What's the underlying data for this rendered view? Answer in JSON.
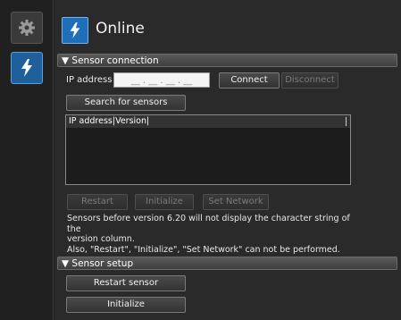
{
  "sidebar": {
    "items": [
      {
        "icon": "gear-icon",
        "label": "Settings"
      },
      {
        "icon": "lightning-icon",
        "label": "Online"
      }
    ],
    "accent": "#1f6fb8"
  },
  "header": {
    "title": "Online",
    "icon": "lightning-icon"
  },
  "sensor_connection": {
    "section_label": "▼ Sensor connection",
    "ip_label": "IP address",
    "ip_value": "__ . __ . __ . __",
    "connect_label": "Connect",
    "disconnect_label": "Disconnect",
    "search_label": "Search for sensors",
    "list_header": "IP address|Version|",
    "restart_label": "Restart",
    "initialize_label": "Initialize",
    "set_network_label": "Set Network",
    "note_line1": "Sensors before version 6.20 will not display the character string of the",
    "note_line2": "version column.",
    "note_line3": "Also, \"Restart\", \"Initialize\", \"Set Network\" can not be performed."
  },
  "sensor_setup": {
    "section_label": "▼ Sensor setup",
    "restart_sensor_label": "Restart sensor",
    "initialize_label": "Initialize"
  }
}
